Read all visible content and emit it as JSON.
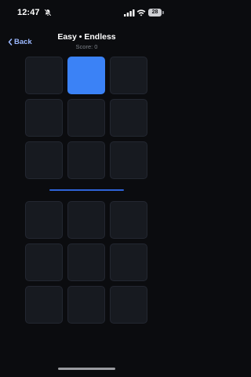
{
  "status_bar": {
    "time": "12:47",
    "battery_level": "28",
    "icons": [
      "bell-slash-icon",
      "signal-icon",
      "wifi-icon",
      "battery-icon"
    ]
  },
  "header": {
    "back_label": "Back",
    "title": "Easy • Endless",
    "score_text": "Score: 0"
  },
  "colors": {
    "background": "#0b0c0f",
    "accent": "#3b82f6",
    "back_link": "#9bb8ff",
    "tile": "#171a20",
    "tile_border": "#232731"
  },
  "top_grid": {
    "rows": 3,
    "columns": 3,
    "active_tiles": [
      1
    ]
  },
  "bottom_grid": {
    "rows": 3,
    "columns": 3,
    "active_tiles": []
  }
}
